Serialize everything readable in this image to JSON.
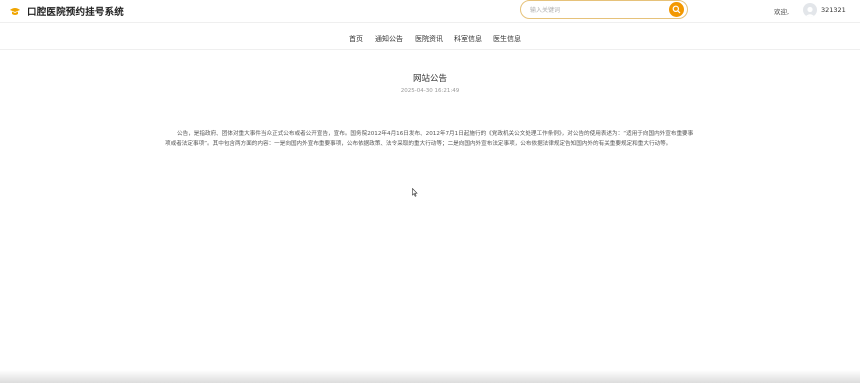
{
  "header": {
    "site_title": "口腔医院预约挂号系统",
    "logo_icon": "hat-icon",
    "search": {
      "placeholder": "输入关键词",
      "value": "",
      "button_icon": "search-icon"
    },
    "welcome": "欢迎,",
    "username": "321321",
    "accent_color": "#f39800"
  },
  "nav": {
    "items": [
      {
        "label": "首页"
      },
      {
        "label": "通知公告"
      },
      {
        "label": "医院资讯"
      },
      {
        "label": "科室信息"
      },
      {
        "label": "医生信息"
      }
    ]
  },
  "article": {
    "title": "网站公告",
    "date": "2025-04-30 16:21:49",
    "content": "公告，是指政府、团体对重大事件当众正式公布或者公开宣告，宣布。国务院2012年4月16日发布、2012年7月1日起施行的《党政机关公文处理工作条例》，对公告的使用表述为：“适用于向国内外宣布重要事项或者法定事项”。其中包含两方面的内容：一是向国内外宣布重要事项，公布依据政策、法令采取的重大行动等；二是向国内外宣布法定事项，公布依据法律规定告知国内外的有关重要规定和重大行动等。"
  }
}
